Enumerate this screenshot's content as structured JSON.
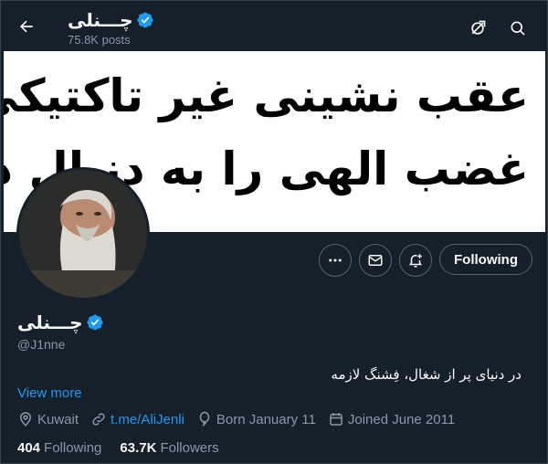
{
  "header": {
    "back_icon": "arrow-left-icon",
    "title": "چـــنلی",
    "posts_count": "75.8K posts",
    "alt_icon": "no-direction-icon",
    "search_icon": "search-icon"
  },
  "banner": {
    "line1": "عقب نشینی غیر تاکتیکی",
    "line2": "غضب الهی را به دنبال دارد"
  },
  "actions": {
    "more_icon": "more-icon",
    "message_icon": "envelope-icon",
    "notify_icon": "bell-plus-icon",
    "follow_label": "Following"
  },
  "profile": {
    "name": "چـــنلی",
    "handle": "@J1nne",
    "bio": "در دنیای پر از شغال، فِشنگ لازمه",
    "view_more": "View more",
    "location": "Kuwait",
    "link": "t.me/AliJenli",
    "born": "Born January 11",
    "joined": "Joined June 2011",
    "following_count": "404",
    "following_label": "Following",
    "followers_count": "63.7K",
    "followers_label": "Followers"
  },
  "colors": {
    "background": "#15202b",
    "accent": "#1d9bf0",
    "muted": "#8b98a5",
    "text": "#f7f9f9"
  }
}
